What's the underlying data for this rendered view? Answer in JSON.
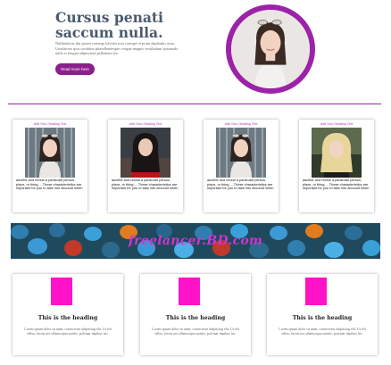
{
  "hero": {
    "title": "Cursus penati saccum nulla.",
    "description": "Nullamlacus dui ipsum consequ lobortis non consque et pruin dapibulus urna. Urnaltrices quis curabitur phasellentesque congue magnis vestibulum quismodo nulla et feugiat adipiscinia pellentum leo.",
    "button_label": "Read more here"
  },
  "profiles": [
    {
      "heading": "Add Your Heading Text",
      "text": "ascribe and reveal a particular person, place, or thing.... These characteristics are important for you to take into account when"
    },
    {
      "heading": "Add Your Heading Text",
      "text": "ascribe and reveal a particular person, place, or thing.... These characteristics are important for you to take into account when"
    },
    {
      "heading": "Add Your Heading Text",
      "text": "ascribe and reveal a particular person, place, or thing.... These characteristics are important for you to take into account when"
    },
    {
      "heading": "Add Your Heading Text",
      "text": "ascribe and reveal a particular person, place, or thing.... These characteristics are important for you to take into account when"
    }
  ],
  "banner": {
    "text": "freelancer.BD.com"
  },
  "features": [
    {
      "title": "This is the heading",
      "text": "Lorem ipsum dolor sit amet, consectetur adipiscing elit. Ut elit tellus, luctus nec ullamcorper mattis, pulvinar dapibus leo."
    },
    {
      "title": "This is the heading",
      "text": "Lorem ipsum dolor sit amet, consectetur adipiscing elit. Ut elit tellus, luctus nec ullamcorper mattis, pulvinar dapibus leo."
    },
    {
      "title": "This is the heading",
      "text": "Lorem ipsum dolor sit amet, consectetur adipiscing elit. Ut elit tellus, luctus nec ullamcorper mattis, pulvinar dapibus leo."
    }
  ],
  "colors": {
    "accent_purple": "#9c23a8",
    "button_purple": "#8b1f8e",
    "feature_magenta": "#ff12c8",
    "banner_text": "#d033d0"
  }
}
